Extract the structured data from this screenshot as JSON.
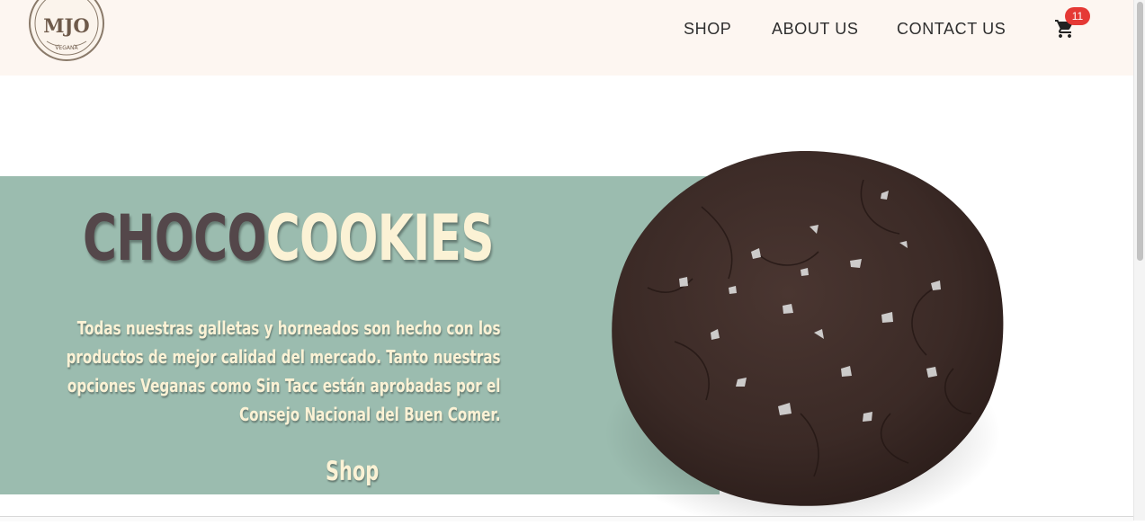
{
  "brand": {
    "logo_text": "MJO",
    "logo_subtext": "VEGANA"
  },
  "nav": {
    "items": [
      {
        "label": "SHOP"
      },
      {
        "label": "ABOUT US"
      },
      {
        "label": "CONTACT US"
      }
    ]
  },
  "cart": {
    "icon": "shopping-cart-icon",
    "count": "11"
  },
  "hero": {
    "title_part1": "CHOCO",
    "title_part2": "COOKIES",
    "description": "Todas nuestras galletas y horneados son hecho con los productos de mejor calidad del mercado. Tanto nuestras opciones Veganas como Sin Tacc están aprobadas por el Consejo Nacional del Buen Comer.",
    "shop_label": "Shop",
    "image": "chocolate-cookie-image"
  },
  "colors": {
    "header_bg": "#fdf6f1",
    "hero_band": "#9bbcaf",
    "title_dark": "#54474a",
    "cream": "#fbf2d5",
    "badge": "#e53935"
  }
}
